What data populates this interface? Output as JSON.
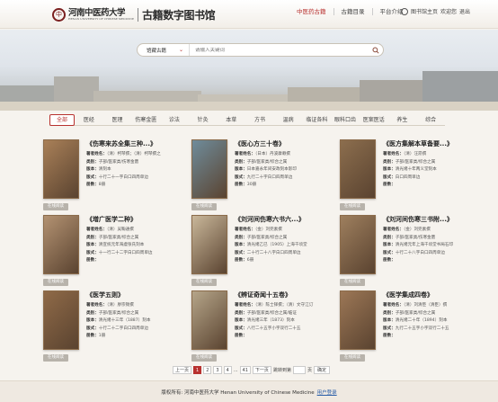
{
  "header": {
    "logo_seal": "中",
    "university_name": "河南中医药大学",
    "university_name_en": "HENAN UNIVERSITY OF CHINESE MEDICINE",
    "library_name": "古籍数字图书馆",
    "nav": [
      "中医药古籍",
      "古籍目录",
      "平台介绍"
    ],
    "user_name": "图书馆主页",
    "user_welcome": "欢迎您",
    "logout": "退出"
  },
  "search": {
    "field_select": "馆藏古籍",
    "placeholder": "请输入关键词"
  },
  "categories": [
    "全部",
    "医经",
    "医理",
    "伤寒金匮",
    "诊法",
    "针灸",
    "本草",
    "方书",
    "温病",
    "临证各科",
    "眼科口齿",
    "医案医话",
    "养生",
    "综合"
  ],
  "active_category": "全部",
  "book_labels": {
    "author": "著者姓名：",
    "category": "类别：",
    "edition": "版本：",
    "format": "版式：",
    "volumes": "册数：",
    "read_button": "在线阅读"
  },
  "books": [
    {
      "title": "《伤寒来苏全集三种...》",
      "author": "（清）柯琴撰；（清）柯琴撰之",
      "category": "子部/医家类/伤寒金匮",
      "edition": "清刻本",
      "format": "十行二十一字白口四周单边",
      "volumes": "8册",
      "cover": "#a98058"
    },
    {
      "title": "《医心方三十卷》",
      "author": "（日本）丹波康赖撰",
      "category": "子部/医家类/综合之属",
      "edition": "日本嘉永年间安政刻本影印",
      "format": "九行二十字白口四周单边",
      "volumes": "30册",
      "cover": "#6f8c9b"
    },
    {
      "title": "《医方集解本草备要...》",
      "author": "（清）汪昂撰",
      "category": "子部/医家类/综合之属",
      "edition": "清光绪十年两义堂刻本",
      "format": "白口四周单边",
      "volumes": "",
      "cover": "#8c6e4e"
    },
    {
      "title": "《增广医学二种》",
      "author": "（清）吴鞠通撰",
      "category": "子部/医家类/综合之属",
      "edition": "清宣统元年海虞张氏刻本",
      "format": "十一行二十二字白口四周单边",
      "volumes": "",
      "cover": "#b39272"
    },
    {
      "title": "《刘河间伤寒六书六...》",
      "author": "（金）刘完素撰",
      "category": "子部/医家类/综合之属",
      "edition": "清光绪乙巳（1905）上海千顷堂",
      "format": "二十行二十八字白口四周单边",
      "volumes": "6册",
      "cover": "#c9b79a"
    },
    {
      "title": "《刘河间伤寒三书附...》",
      "author": "（金）刘完素撰",
      "category": "子部/医家类/伤寒金匮",
      "edition": "清光绪元年上海千顷堂书局石印",
      "format": "十行二十八字白口四周单边",
      "volumes": "",
      "cover": "#9e7f5e"
    },
    {
      "title": "《医学五则》",
      "author": "（清）廖宗锡撰",
      "category": "子部/医家类/综合之属",
      "edition": "清光绪十三年（1887）刻本",
      "format": "十行二十二字白口四周单边",
      "volumes": "1册",
      "cover": "#8f6a48"
    },
    {
      "title": "《辨证奇闻十五卷》",
      "author": "（清）陈士铎撰；（清）文守江订",
      "category": "子部/医家类/综合之属/临证",
      "edition": "清光绪三年（1873）刻本",
      "format": "八行二十五字小字双行二十五",
      "volumes": "",
      "cover": "#b5a589"
    },
    {
      "title": "《医学集成四卷》",
      "author": "（清）刘清臣（清臣）撰",
      "category": "子部/医家类/综合之属",
      "edition": "清光绪二十年（1894）刻本",
      "format": "九行二十五字小字双行二十五",
      "volumes": "",
      "cover": "#9c7756"
    }
  ],
  "pagination": {
    "prev": "上一页",
    "pages": [
      "1",
      "2",
      "3",
      "4",
      "...",
      "41"
    ],
    "active_page": "1",
    "next": "下一页",
    "goto_label": "跳转到第",
    "page_suffix": "页",
    "confirm": "确定"
  },
  "footer": {
    "text": "版权所有: 河南中医药大学 Henan University of Chinese Medicine",
    "link": "用户登录"
  },
  "colors": {
    "accent": "#b8312f",
    "background": "#f6f3ee"
  }
}
